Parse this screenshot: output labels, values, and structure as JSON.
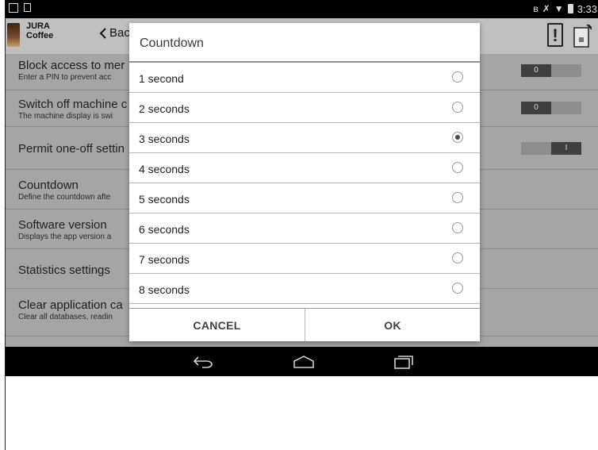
{
  "status_bar": {
    "time": "3:33",
    "left_icons": [
      "notification-square-icon",
      "sd-card-icon"
    ],
    "right_icons": [
      "bluetooth-icon",
      "mute-icon",
      "wifi-icon",
      "battery-icon"
    ]
  },
  "app": {
    "brand_line1": "JURA",
    "brand_line2": "Coffee",
    "back_label": "Bac",
    "header_icons": [
      "warning-icon",
      "coffee-machine-icon"
    ]
  },
  "settings": [
    {
      "title": "Block access to mer",
      "desc": "Enter a PIN to prevent acc",
      "toggle": "0"
    },
    {
      "title": "Switch off machine c",
      "desc": "The machine display is swi",
      "toggle": "0"
    },
    {
      "title": "Permit one-off settin",
      "desc": "",
      "toggle": "I"
    },
    {
      "title": "Countdown",
      "desc": "Define the countdown afte",
      "toggle": ""
    },
    {
      "title": "Software version",
      "desc": "Displays the app version a",
      "toggle": ""
    },
    {
      "title": "Statistics settings",
      "desc": "",
      "toggle": ""
    },
    {
      "title": "Clear application ca",
      "desc": "Clear all databases, readin",
      "toggle": ""
    }
  ],
  "dialog": {
    "title": "Countdown",
    "selected_index": 2,
    "options": [
      "1 second",
      "2 seconds",
      "3 seconds",
      "4 seconds",
      "5 seconds",
      "6 seconds",
      "7 seconds",
      "8 seconds"
    ],
    "cancel_label": "CANCEL",
    "ok_label": "OK"
  },
  "nav_bar": {
    "icons": [
      "back-arrow-icon",
      "home-icon",
      "recent-apps-icon"
    ]
  },
  "colors": {
    "dim_overlay": "#a5a5a5",
    "status_bar": "#000000",
    "dialog_bg": "#ffffff"
  }
}
